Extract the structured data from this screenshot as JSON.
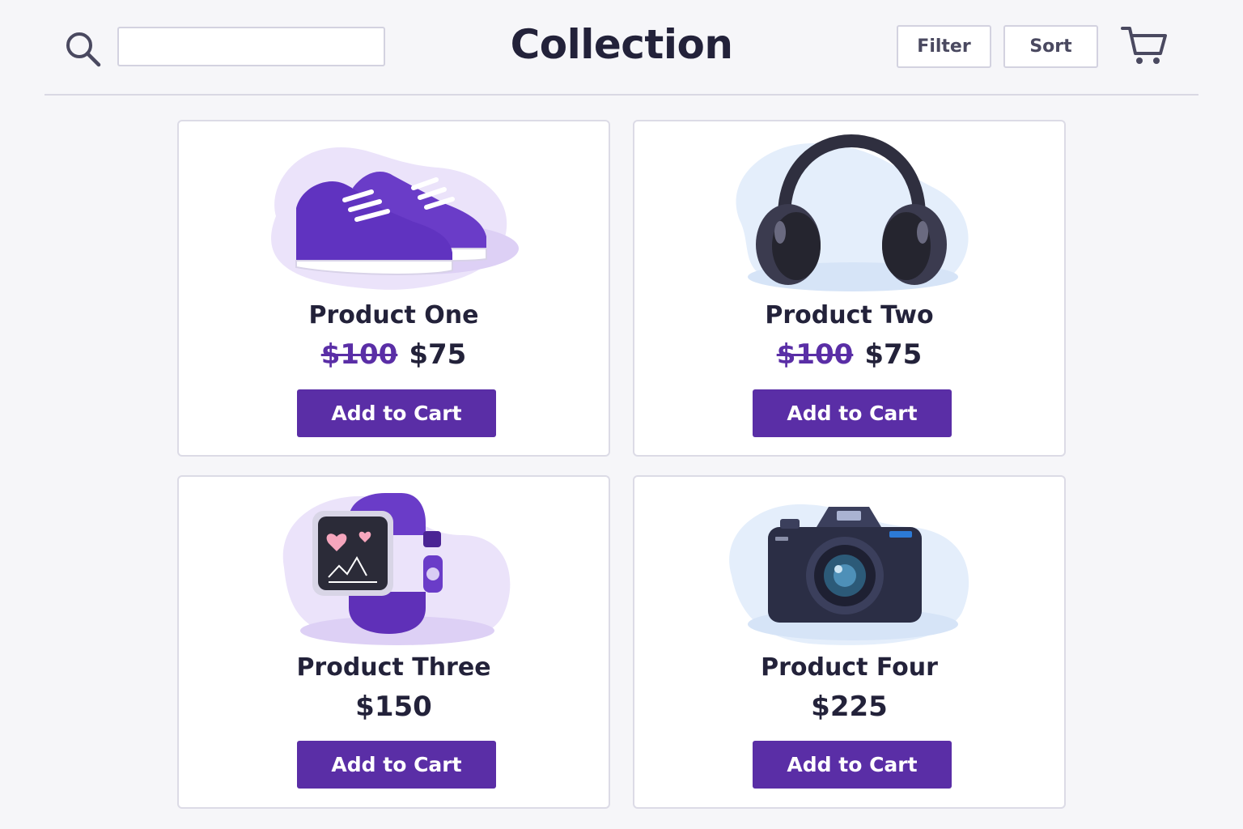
{
  "header": {
    "title": "Collection",
    "search_placeholder": "",
    "filter_label": "Filter",
    "sort_label": "Sort",
    "icons": {
      "search": "search-icon",
      "cart": "cart-icon"
    }
  },
  "products": [
    {
      "name": "Product One",
      "old_price": "$100",
      "price": "$75",
      "button": "Add to Cart",
      "image": "sneakers"
    },
    {
      "name": "Product Two",
      "old_price": "$100",
      "price": "$75",
      "button": "Add to Cart",
      "image": "headphones"
    },
    {
      "name": "Product Three",
      "old_price": "",
      "price": "$150",
      "button": "Add to Cart",
      "image": "smartwatch"
    },
    {
      "name": "Product Four",
      "old_price": "",
      "price": "$225",
      "button": "Add to Cart",
      "image": "camera"
    }
  ],
  "colors": {
    "accent": "#5a2ea6",
    "text": "#23223a",
    "background": "#f6f6f9",
    "border": "#dcdbe6"
  }
}
